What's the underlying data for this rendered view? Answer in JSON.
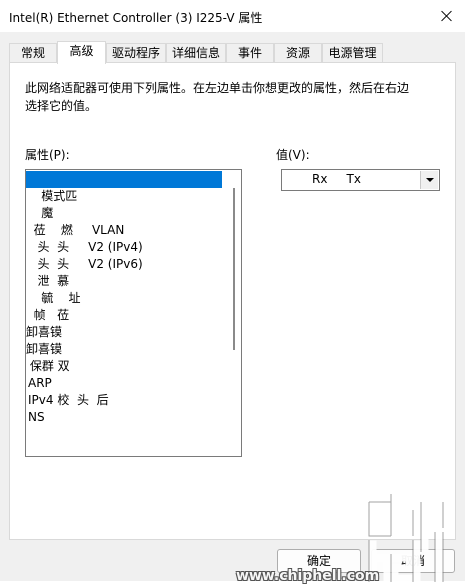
{
  "window": {
    "title": "Intel(R) Ethernet Controller (3) I225-V 属性"
  },
  "tabs": [
    {
      "label": "常规"
    },
    {
      "label": "高级"
    },
    {
      "label": "驱动程序"
    },
    {
      "label": "详细信息"
    },
    {
      "label": "事件"
    },
    {
      "label": "资源"
    },
    {
      "label": "电源管理"
    }
  ],
  "advanced": {
    "description": "此网络适配器可使用下列属性。在左边单击你想更改的属性，然后在右边选择它的值。",
    "property_label": "属性(P):",
    "value_label": "值(V):",
    "properties": [
      {
        "label": ""
      },
      {
        "label": "    模式匹"
      },
      {
        "label": "    魔"
      },
      {
        "label": "  莅    燃     VLAN"
      },
      {
        "label": "   头  头     V2 (IPv4)"
      },
      {
        "label": "   头  头     V2 (IPv6)"
      },
      {
        "label": "   泄  慕"
      },
      {
        "label": "    毓    址"
      },
      {
        "label": "  帧   莅"
      },
      {
        "label": "卸喜镆"
      },
      {
        "label": "卸喜镆"
      },
      {
        "label": " 保群 双"
      },
      {
        "label": "ARP"
      },
      {
        "label": "IPv4 校  头  后"
      },
      {
        "label": "NS"
      }
    ],
    "selected_value": "Rx     Tx"
  },
  "buttons": {
    "ok": "确定",
    "cancel": "取消"
  },
  "watermark": {
    "url": "www.chiphell.com",
    "logo": "chiphell-logo"
  }
}
